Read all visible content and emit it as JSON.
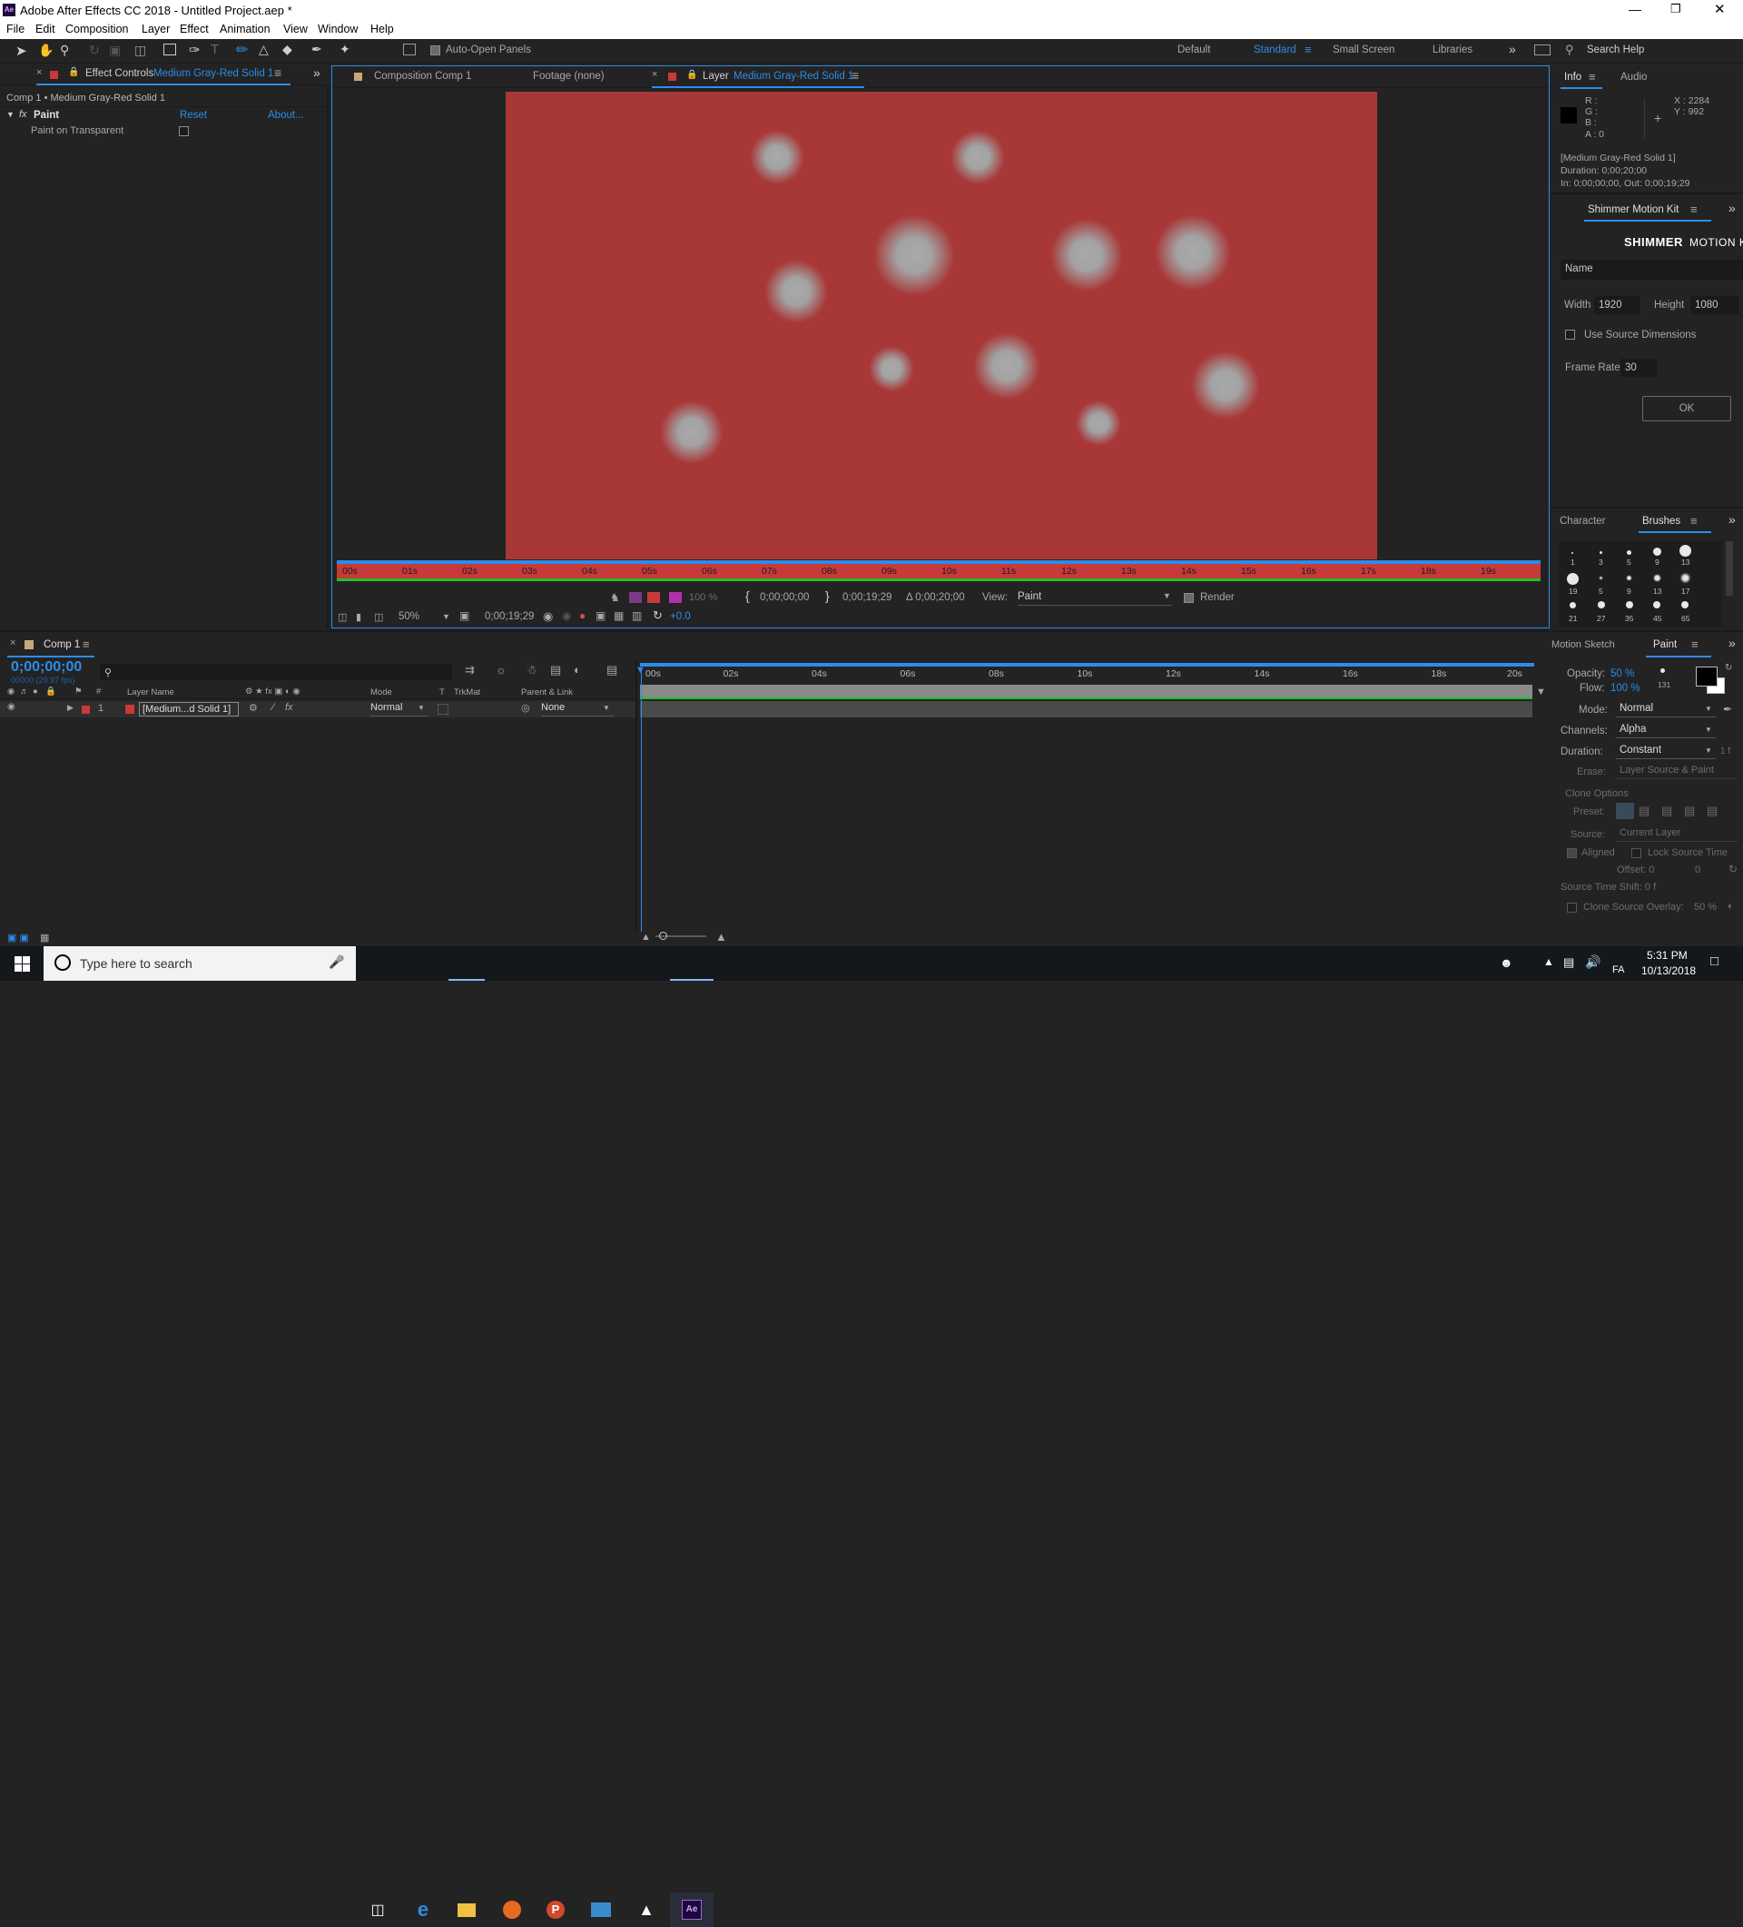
{
  "app_title": "Adobe After Effects CC 2018 - Untitled Project.aep *",
  "menu": [
    "File",
    "Edit",
    "Composition",
    "Layer",
    "Effect",
    "Animation",
    "View",
    "Window",
    "Help"
  ],
  "toolbar": {
    "auto_open": "Auto-Open Panels",
    "workspaces": [
      "Default",
      "Standard",
      "Small Screen",
      "Libraries"
    ],
    "search": "Search Help"
  },
  "effect_controls": {
    "tab_prefix": "Effect Controls",
    "tab_layer": "Medium Gray-Red Solid 1",
    "path": "Comp 1 • Medium Gray-Red Solid 1",
    "effect_name": "Paint",
    "reset": "Reset",
    "about": "About...",
    "param": "Paint on Transparent"
  },
  "viewer": {
    "tabs": [
      "Composition Comp 1",
      "Footage (none)",
      "Layer"
    ],
    "layer_name": "Medium Gray-Red Solid 1",
    "ruler": [
      "00s",
      "01s",
      "02s",
      "03s",
      "04s",
      "05s",
      "06s",
      "07s",
      "08s",
      "09s",
      "10s",
      "11s",
      "12s",
      "13s",
      "14s",
      "15s",
      "16s",
      "17s",
      "18s",
      "19s"
    ],
    "zoom": "50%",
    "timecode": "0;00;19;29",
    "in_point": "0;00;00;00",
    "out_point": "0;00;19;29",
    "duration": "Δ 0;00;20;00",
    "view_label": "View:",
    "view_value": "Paint",
    "render": "Render",
    "exposure": "+0.0",
    "opacity_pct": "100 %"
  },
  "info": {
    "tabs": [
      "Info",
      "Audio"
    ],
    "r": "R :",
    "g": "G :",
    "b": "B :",
    "a": "A : 0",
    "x": "X : 2284",
    "y": "Y : 992",
    "layer": "[Medium Gray-Red Solid 1]",
    "duration": "Duration: 0;00;20;00",
    "inout": "In: 0;00;00;00, Out: 0;00;19;29"
  },
  "shimmer": {
    "tab": "Shimmer Motion Kit",
    "brand_bold": "SHIMMER",
    "brand_light": "MOTION K",
    "name_placeholder": "Name",
    "width_label": "Width",
    "width": "1920",
    "height_label": "Height",
    "height": "1080",
    "use_source": "Use Source Dimensions",
    "frame_rate_label": "Frame Rate",
    "frame_rate": "30",
    "ok": "OK"
  },
  "brushes": {
    "tabs": [
      "Character",
      "Brushes"
    ],
    "sizes_row1": [
      "1",
      "3",
      "5",
      "9",
      "13"
    ],
    "sizes_row2": [
      "19",
      "5",
      "9",
      "13",
      "17"
    ],
    "sizes_row3": [
      "21",
      "27",
      "35",
      "45",
      "65"
    ]
  },
  "timeline": {
    "comp_tab": "Comp 1",
    "timecode": "0;00;00;00",
    "fps": "00000 (29.97 fps)",
    "headers": {
      "name": "Layer Name",
      "mode": "Mode",
      "t": "T",
      "trkmat": "TrkMat",
      "parent": "Parent & Link"
    },
    "layer": {
      "num": "1",
      "name": "[Medium...d Solid 1]",
      "mode": "Normal",
      "parent": "None"
    },
    "ruler": [
      "00s",
      "02s",
      "04s",
      "06s",
      "08s",
      "10s",
      "12s",
      "14s",
      "16s",
      "18s",
      "20s"
    ]
  },
  "paint": {
    "tabs": [
      "Motion Sketch",
      "Paint"
    ],
    "opacity_label": "Opacity:",
    "opacity": "50 %",
    "flow_label": "Flow:",
    "flow": "100 %",
    "brush_size": "131",
    "mode_label": "Mode:",
    "mode": "Normal",
    "channels_label": "Channels:",
    "channels": "Alpha",
    "duration_label": "Duration:",
    "duration": "Constant",
    "erase_label": "Erase:",
    "erase": "Layer Source & Paint",
    "clone_options": "Clone Options",
    "preset_label": "Preset:",
    "source_label": "Source:",
    "source": "Current Layer",
    "aligned": "Aligned",
    "lock_source": "Lock Source Time",
    "offset": "Offset: 0",
    "offset2": "0",
    "source_shift": "Source Time Shift: 0 f",
    "clone_overlay": "Clone Source Overlay:",
    "clone_overlay_pct": "50 %"
  },
  "taskbar": {
    "search": "Type here to search",
    "lang": "FA",
    "time": "5:31 PM",
    "date": "10/13/2018"
  },
  "colors": {
    "accent": "#2d8ceb",
    "canvas": "#a83838",
    "label_red": "#c83a3a"
  }
}
